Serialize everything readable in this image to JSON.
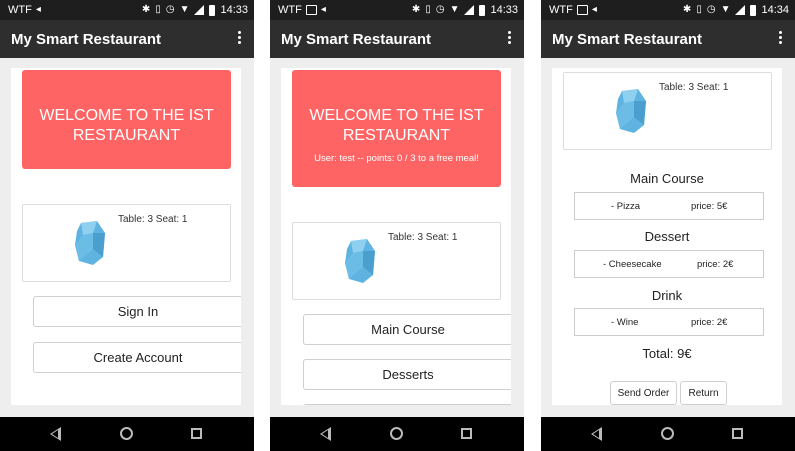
{
  "statusbar": {
    "carrier": "WTF",
    "time": "14:33",
    "time_3": "14:34"
  },
  "app": {
    "title": "My Smart Restaurant"
  },
  "colors": {
    "banner": "#ff6464",
    "appbar": "#2e2e2e",
    "statusbar": "#1e1e1e",
    "beacon": "#5fb3e0"
  },
  "screen1": {
    "banner_title": "WELCOME TO THE IST RESTAURANT",
    "table_seat": "Table: 3 Seat: 1",
    "sign_in": "Sign In",
    "create_account": "Create Account"
  },
  "screen2": {
    "banner_title": "WELCOME TO THE IST RESTAURANT",
    "banner_sub": "User: test -- points: 0 / 3 to a free meal!",
    "table_seat": "Table: 3 Seat: 1",
    "main_course": "Main Course",
    "desserts": "Desserts"
  },
  "screen3": {
    "table_seat": "Table: 3 Seat: 1",
    "sections": [
      {
        "title": "Main Course",
        "item": "- Pizza",
        "price": "price: 5€"
      },
      {
        "title": "Dessert",
        "item": "- Cheesecake",
        "price": "price: 2€"
      },
      {
        "title": "Drink",
        "item": "- Wine",
        "price": "price: 2€"
      }
    ],
    "total": "Total: 9€",
    "send_order": "Send Order",
    "return": "Return"
  },
  "icons": {
    "status": [
      "picture-icon",
      "back-arrow-icon",
      "bluetooth-icon",
      "vibrate-icon",
      "alarm-icon",
      "wifi-icon",
      "signal-icon",
      "battery-icon"
    ],
    "nav": [
      "back-icon",
      "home-icon",
      "recents-icon"
    ],
    "beacon": "estimote-beacon-icon"
  }
}
